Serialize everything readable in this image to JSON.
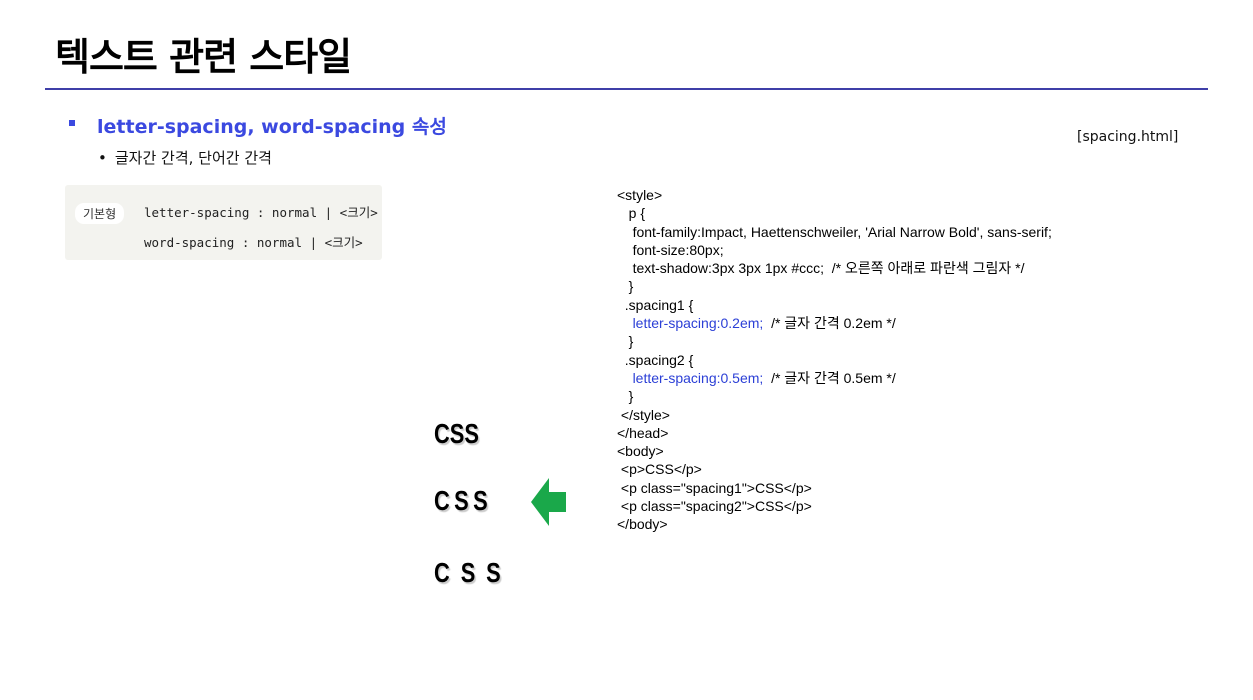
{
  "header": {
    "title": "텍스트 관련 스타일"
  },
  "section": {
    "heading": "letter-spacing, word-spacing 속성",
    "sub_bullet": "•",
    "sub_text": "글자간 간격, 단어간 간격",
    "filename": "[spacing.html]"
  },
  "syntax": {
    "badge": "기본형",
    "line1": "letter-spacing : normal | <크기>",
    "line2": "word-spacing : normal | <크기>"
  },
  "code": {
    "lines": [
      {
        "indent": "",
        "text": "<style>",
        "blue": ""
      },
      {
        "indent": "   ",
        "text": "p {",
        "blue": ""
      },
      {
        "indent": "    ",
        "text": "font-family:Impact, Haettenschweiler, 'Arial Narrow Bold', sans-serif;",
        "blue": ""
      },
      {
        "indent": "    ",
        "text": "font-size:80px;",
        "blue": ""
      },
      {
        "indent": "    ",
        "text": "text-shadow:3px 3px 1px #ccc;  /* 오른쪽 아래로 파란색 그림자 */",
        "blue": ""
      },
      {
        "indent": "   ",
        "text": "}",
        "blue": ""
      },
      {
        "indent": "  ",
        "text": ".spacing1 {",
        "blue": ""
      },
      {
        "indent": "    ",
        "text": "  /* 글자 간격 0.2em */",
        "blue": "letter-spacing:0.2em;"
      },
      {
        "indent": "   ",
        "text": "}",
        "blue": ""
      },
      {
        "indent": "  ",
        "text": ".spacing2 {",
        "blue": ""
      },
      {
        "indent": "    ",
        "text": "  /* 글자 간격 0.5em */",
        "blue": "letter-spacing:0.5em;"
      },
      {
        "indent": "   ",
        "text": "}",
        "blue": ""
      },
      {
        "indent": " ",
        "text": "</style>",
        "blue": ""
      },
      {
        "indent": "",
        "text": "</head>",
        "blue": ""
      },
      {
        "indent": "",
        "text": "<body>",
        "blue": ""
      },
      {
        "indent": " ",
        "text": "<p>CSS</p>",
        "blue": ""
      },
      {
        "indent": " ",
        "text": "<p class=\"spacing1\">CSS</p>",
        "blue": ""
      },
      {
        "indent": " ",
        "text": "<p class=\"spacing2\">CSS</p>",
        "blue": ""
      },
      {
        "indent": "",
        "text": "</body>",
        "blue": ""
      }
    ]
  },
  "demo": {
    "normal": "CSS",
    "spacing1": "CSS",
    "spacing2": "CSS",
    "spacing1_em": 0.2,
    "spacing2_em": 0.5
  },
  "colors": {
    "accent_blue": "#3b49e0",
    "arrow_green": "#1aa84a"
  },
  "icons": {
    "pointer": "arrow-left-icon"
  }
}
